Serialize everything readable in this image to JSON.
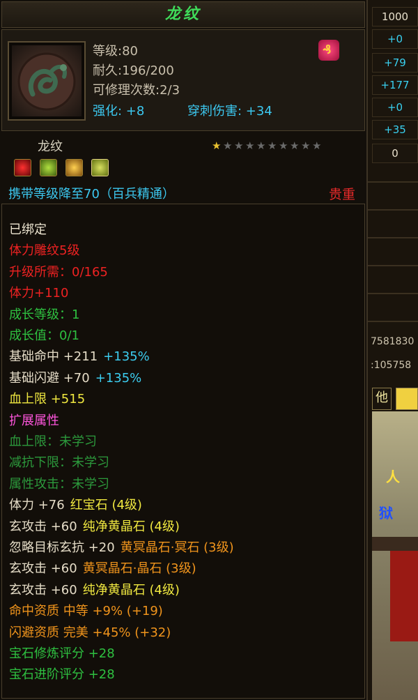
{
  "item": {
    "title": "龙纹",
    "name": "龙纹",
    "level": "等级:80",
    "durability": "耐久:196/200",
    "repairs": "可修理次数:2/3",
    "enhance": "强化: +8",
    "pierce": "穿刺伤害: +34",
    "stars_total": 10,
    "stars_lit": 1,
    "carry": "携带等级降至70（百兵精通）",
    "precious": "贵重"
  },
  "side_panel": {
    "values": [
      "1000",
      "+0",
      "+79",
      "+177",
      "+0",
      "+35",
      "0"
    ],
    "text1": "7581830",
    "text2": ":105758",
    "tab": "他",
    "scene_text1": "人",
    "scene_text2": "狱"
  },
  "attributes": [
    {
      "text": "已绑定",
      "color": "w"
    },
    {
      "text": "体力雕纹5级",
      "color": "r"
    },
    {
      "text": "升级所需：0/165",
      "color": "r"
    },
    {
      "text": "体力+110",
      "color": "r"
    },
    {
      "text": "成长等级：1",
      "color": "g"
    },
    {
      "text": "成长值：0/1",
      "color": "g"
    },
    {
      "text": "基础命中 +211",
      "extra": "+135%",
      "color": "wl",
      "extra_color": "c"
    },
    {
      "text": "基础闪避 +70",
      "extra": "+135%",
      "color": "wl",
      "extra_color": "c"
    },
    {
      "text": "血上限 +515",
      "color": "y"
    },
    {
      "text": "扩展属性",
      "color": "p"
    },
    {
      "text": "血上限：未学习",
      "color": "dg"
    },
    {
      "text": "减抗下限：未学习",
      "color": "dg"
    },
    {
      "text": "属性攻击：未学习",
      "color": "dg"
    },
    {
      "text": "体力 +76",
      "extra": "红宝石 (4级)",
      "color": "wl",
      "extra_color": "y"
    },
    {
      "text": "玄攻击 +60",
      "extra": "纯净黄晶石 (4级)",
      "color": "wl",
      "extra_color": "y"
    },
    {
      "text": "忽略目标玄抗 +20",
      "extra": "黄冥晶石·冥石 (3级)",
      "color": "wl",
      "extra_color": "o"
    },
    {
      "text": "玄攻击 +60",
      "extra": "黄冥晶石·晶石 (3级)",
      "color": "wl",
      "extra_color": "o"
    },
    {
      "text": "玄攻击 +60",
      "extra": "纯净黄晶石 (4级)",
      "color": "wl",
      "extra_color": "y"
    },
    {
      "text": "命中资质  中等 +9% (+19)",
      "color": "o"
    },
    {
      "text": "闪避资质  完美 +45% (+32)",
      "color": "o"
    },
    {
      "text": "宝石修炼评分 +28",
      "color": "g"
    },
    {
      "text": "宝石进阶评分 +28",
      "color": "g"
    }
  ]
}
